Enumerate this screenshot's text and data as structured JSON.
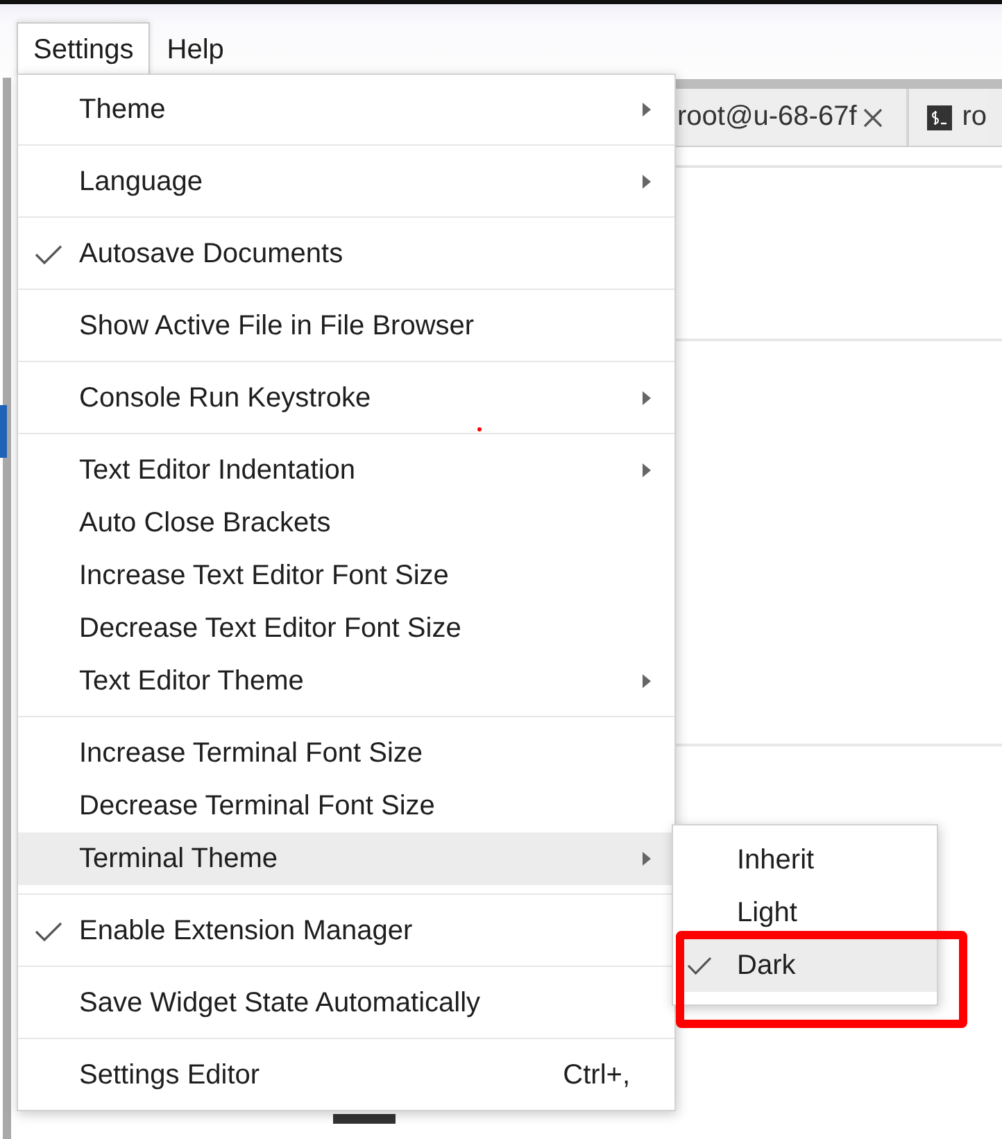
{
  "menubar": {
    "items": [
      {
        "label": "Settings",
        "selected": true
      },
      {
        "label": "Help",
        "selected": false
      }
    ]
  },
  "tabs": [
    {
      "kind": "closable",
      "label": "root@u-68-67f"
    },
    {
      "kind": "terminal",
      "label": "ro"
    }
  ],
  "settings_menu": {
    "groups": [
      {
        "items": [
          {
            "label": "Theme",
            "checked": false,
            "submenu": true,
            "selected": false
          }
        ]
      },
      {
        "items": [
          {
            "label": "Language",
            "checked": false,
            "submenu": true,
            "selected": false
          }
        ]
      },
      {
        "items": [
          {
            "label": "Autosave Documents",
            "checked": true,
            "submenu": false,
            "selected": false
          }
        ]
      },
      {
        "items": [
          {
            "label": "Show Active File in File Browser",
            "checked": false,
            "submenu": false,
            "selected": false
          }
        ]
      },
      {
        "items": [
          {
            "label": "Console Run Keystroke",
            "checked": false,
            "submenu": true,
            "selected": false
          }
        ]
      },
      {
        "items": [
          {
            "label": "Text Editor Indentation",
            "checked": false,
            "submenu": true,
            "selected": false
          },
          {
            "label": "Auto Close Brackets",
            "checked": false,
            "submenu": false,
            "selected": false
          },
          {
            "label": "Increase Text Editor Font Size",
            "checked": false,
            "submenu": false,
            "selected": false
          },
          {
            "label": "Decrease Text Editor Font Size",
            "checked": false,
            "submenu": false,
            "selected": false
          },
          {
            "label": "Text Editor Theme",
            "checked": false,
            "submenu": true,
            "selected": false
          }
        ]
      },
      {
        "items": [
          {
            "label": "Increase Terminal Font Size",
            "checked": false,
            "submenu": false,
            "selected": false
          },
          {
            "label": "Decrease Terminal Font Size",
            "checked": false,
            "submenu": false,
            "selected": false
          },
          {
            "label": "Terminal Theme",
            "checked": false,
            "submenu": true,
            "selected": true
          }
        ]
      },
      {
        "items": [
          {
            "label": "Enable Extension Manager",
            "checked": true,
            "submenu": false,
            "selected": false
          }
        ]
      },
      {
        "items": [
          {
            "label": "Save Widget State Automatically",
            "checked": false,
            "submenu": false,
            "selected": false
          }
        ]
      },
      {
        "items": [
          {
            "label": "Settings Editor",
            "checked": false,
            "submenu": false,
            "selected": false,
            "shortcut": "Ctrl+,"
          }
        ]
      }
    ]
  },
  "terminal_theme_submenu": {
    "items": [
      {
        "label": "Inherit",
        "checked": false,
        "selected": false
      },
      {
        "label": "Light",
        "checked": false,
        "selected": false
      },
      {
        "label": "Dark",
        "checked": true,
        "selected": true
      }
    ]
  }
}
